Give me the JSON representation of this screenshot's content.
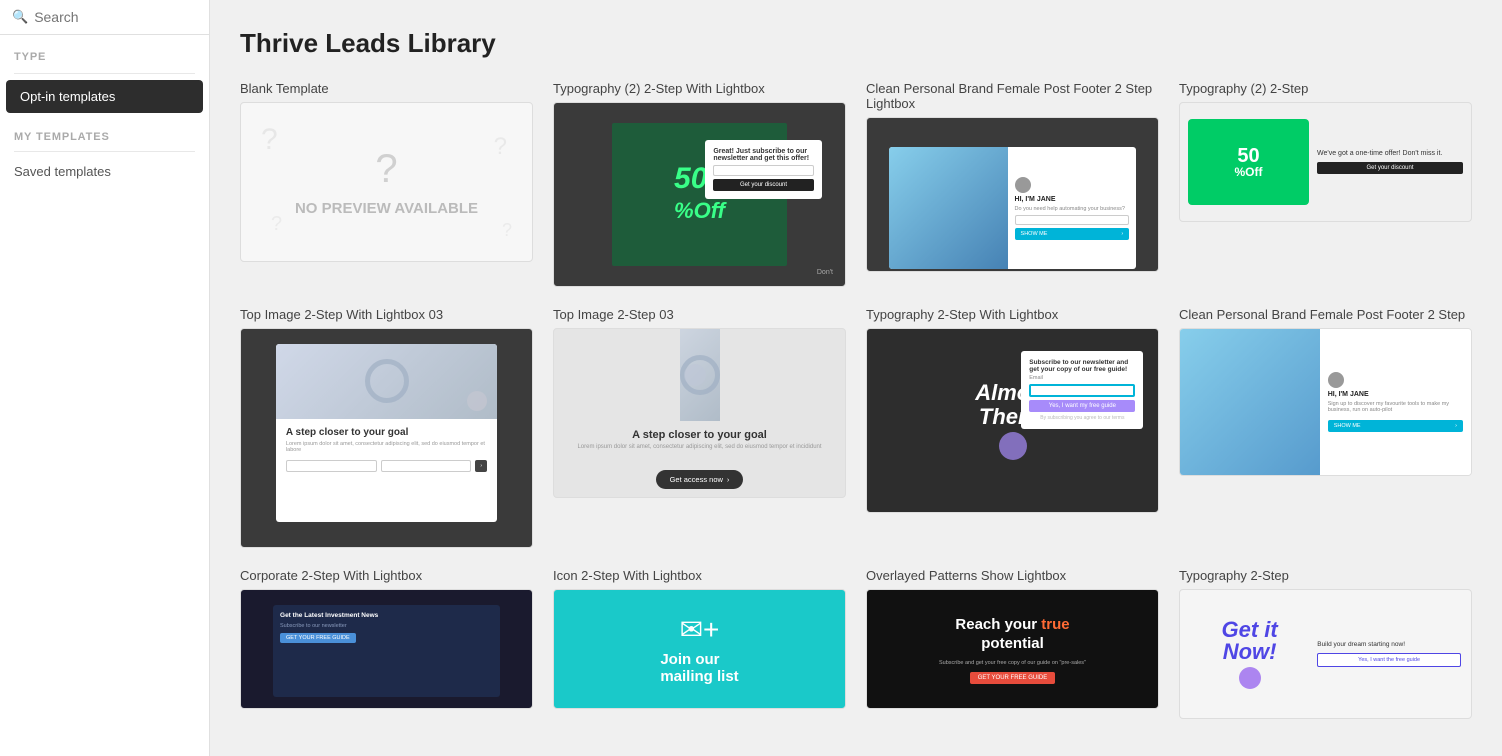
{
  "sidebar": {
    "search_placeholder": "Search",
    "close_icon": "×",
    "type_label": "TYPE",
    "optin_label": "Opt-in templates",
    "my_templates_label": "MY TEMPLATES",
    "saved_templates_label": "Saved templates"
  },
  "main": {
    "page_title": "Thrive Leads Library",
    "templates": [
      {
        "id": "blank",
        "label": "Blank Template",
        "preview_type": "blank"
      },
      {
        "id": "typo2-lightbox",
        "label": "Typography (2) 2-Step With Lightbox",
        "preview_type": "typo2-lightbox"
      },
      {
        "id": "clean-brand-footer",
        "label": "Clean Personal Brand Female Post Footer 2 Step Lightbox",
        "preview_type": "clean-brand"
      },
      {
        "id": "typo2-step-small",
        "label": "Typography (2) 2-Step",
        "preview_type": "typo2-small"
      },
      {
        "id": "top-image-lightbox-03",
        "label": "Top Image 2-Step With Lightbox 03",
        "preview_type": "top-image-lightbox"
      },
      {
        "id": "top-image-03",
        "label": "Top Image 2-Step 03",
        "preview_type": "top-image-center"
      },
      {
        "id": "typo2-dark-lightbox",
        "label": "Typography 2-Step With Lightbox",
        "preview_type": "typo2-dark"
      },
      {
        "id": "clean-brand2",
        "label": "Clean Personal Brand Female Post Footer 2 Step",
        "preview_type": "clean-brand2"
      },
      {
        "id": "corp-lightbox",
        "label": "Corporate 2-Step With Lightbox",
        "preview_type": "corp"
      },
      {
        "id": "icon-lightbox",
        "label": "Icon 2-Step With Lightbox",
        "preview_type": "icon-lightbox"
      },
      {
        "id": "overlay-patterns",
        "label": "Overlayed Patterns Show Lightbox",
        "preview_type": "overlay-patterns"
      },
      {
        "id": "typo2-step-right",
        "label": "Typography 2-Step",
        "preview_type": "typo2-step-right"
      }
    ]
  }
}
